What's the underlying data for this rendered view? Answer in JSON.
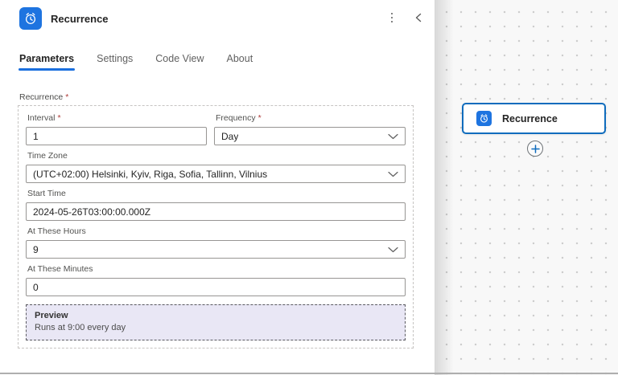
{
  "panel": {
    "header": {
      "title": "Recurrence",
      "icon": "alarm-clock-icon",
      "menu_icon": "kebab-menu-icon",
      "collapse_icon": "chevron-left-icon"
    },
    "tabs": [
      {
        "label": "Parameters",
        "active": true
      },
      {
        "label": "Settings",
        "active": false
      },
      {
        "label": "Code View",
        "active": false
      },
      {
        "label": "About",
        "active": false
      }
    ],
    "form": {
      "required_mark": "*",
      "group_label": "Recurrence",
      "fields": {
        "interval": {
          "label": "Interval",
          "required": true,
          "value": "1",
          "type": "text"
        },
        "frequency": {
          "label": "Frequency",
          "required": true,
          "value": "Day",
          "type": "select"
        },
        "timezone": {
          "label": "Time Zone",
          "required": false,
          "value": "(UTC+02:00) Helsinki, Kyiv, Riga, Sofia, Tallinn, Vilnius",
          "type": "select"
        },
        "start_time": {
          "label": "Start Time",
          "required": false,
          "value": "2024-05-26T03:00:00.000Z",
          "type": "text"
        },
        "at_hours": {
          "label": "At These Hours",
          "required": false,
          "value": "9",
          "type": "select"
        },
        "at_minutes": {
          "label": "At These Minutes",
          "required": false,
          "value": "0",
          "type": "text"
        }
      },
      "preview": {
        "title": "Preview",
        "text": "Runs at 9:00 every day"
      }
    }
  },
  "canvas": {
    "node": {
      "label": "Recurrence",
      "icon": "alarm-clock-icon",
      "selected": true
    },
    "add_button_icon": "plus-icon"
  },
  "colors": {
    "accent_blue": "#0F6CBD",
    "tab_underline_blue": "#1A6FDE",
    "icon_tile_blue": "#1E74E0",
    "required_red": "#AD3A38",
    "preview_bg": "#E9E7F5",
    "canvas_bg": "#F8F8F8"
  }
}
